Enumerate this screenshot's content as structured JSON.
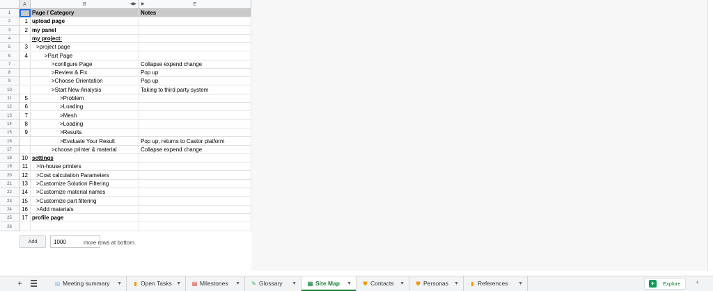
{
  "columns": {
    "a": "A",
    "b": "B",
    "e": "E"
  },
  "header": {
    "page_category": "Page / Category",
    "notes": "Notes"
  },
  "rows": [
    {
      "num": "",
      "cat": "",
      "notes": ""
    },
    {
      "num": "1",
      "cat": "upload page",
      "notes": ""
    },
    {
      "num": "2",
      "cat": "my panel",
      "notes": ""
    },
    {
      "num": "",
      "cat": "my project:",
      "notes": ""
    },
    {
      "num": "3",
      "cat": ">project page",
      "notes": ""
    },
    {
      "num": "4",
      "cat": ">Part Page",
      "notes": ""
    },
    {
      "num": "",
      "cat": ">configure Page",
      "notes": "Collapse expend change"
    },
    {
      "num": "",
      "cat": ">Review & Fix",
      "notes": "Pop up"
    },
    {
      "num": "",
      "cat": ">Choose Orientation",
      "notes": "Pop up"
    },
    {
      "num": "",
      "cat": ">Start New Analysis",
      "notes": "Taking to third party system"
    },
    {
      "num": "5",
      "cat": ">Problem",
      "notes": ""
    },
    {
      "num": "6",
      "cat": ">Loading",
      "notes": ""
    },
    {
      "num": "7",
      "cat": ">Mesh",
      "notes": ""
    },
    {
      "num": "8",
      "cat": ">Loading",
      "notes": ""
    },
    {
      "num": "9",
      "cat": ">Results",
      "notes": ""
    },
    {
      "num": "",
      "cat": ">Evaluate Your Result",
      "notes": "Pop up, returns to Castor platform"
    },
    {
      "num": "",
      "cat": ">choose printer & material",
      "notes": "Collapse expend change"
    },
    {
      "num": "10",
      "cat": "settings",
      "notes": ""
    },
    {
      "num": "11",
      "cat": ">In-house printers",
      "notes": ""
    },
    {
      "num": "12",
      "cat": ">Cost calculation Parameters",
      "notes": ""
    },
    {
      "num": "13",
      "cat": ">Customize Solution Filtering",
      "notes": ""
    },
    {
      "num": "14",
      "cat": ">Customize material names",
      "notes": ""
    },
    {
      "num": "15",
      "cat": ">Customize part filtering",
      "notes": ""
    },
    {
      "num": "16",
      "cat": ">Add materials",
      "notes": ""
    },
    {
      "num": "17",
      "cat": "profile page",
      "notes": ""
    },
    {
      "num": "",
      "cat": "",
      "notes": ""
    }
  ],
  "row_numbers": [
    "1",
    "2",
    "3",
    "4",
    "5",
    "6",
    "7",
    "8",
    "9",
    "10",
    "11",
    "12",
    "13",
    "14",
    "15",
    "16",
    "17",
    "18",
    "19",
    "20",
    "21",
    "22",
    "23",
    "24",
    "25",
    "26"
  ],
  "add_rows": {
    "button": "Add",
    "count": "1000",
    "label": "more rows at bottom."
  },
  "tabs": [
    {
      "label": "Meeting summary",
      "icon": "doc-icon",
      "color": "#8ab4f8"
    },
    {
      "label": "Open Tasks",
      "icon": "bookmark-icon",
      "color": "#f29900"
    },
    {
      "label": "Milestones",
      "icon": "doc-icon",
      "color": "#d93025"
    },
    {
      "label": "Glossary",
      "icon": "pencil-icon",
      "color": "#34a853"
    },
    {
      "label": "Site Map",
      "icon": "doc-icon",
      "color": "#188038",
      "active": true
    },
    {
      "label": "Contacts",
      "icon": "shield-icon",
      "color": "#f29900"
    },
    {
      "label": "Personas",
      "icon": "shield-icon",
      "color": "#f29900"
    },
    {
      "label": "References",
      "icon": "bookmark-icon",
      "color": "#f29900"
    }
  ],
  "explore": "Explore"
}
